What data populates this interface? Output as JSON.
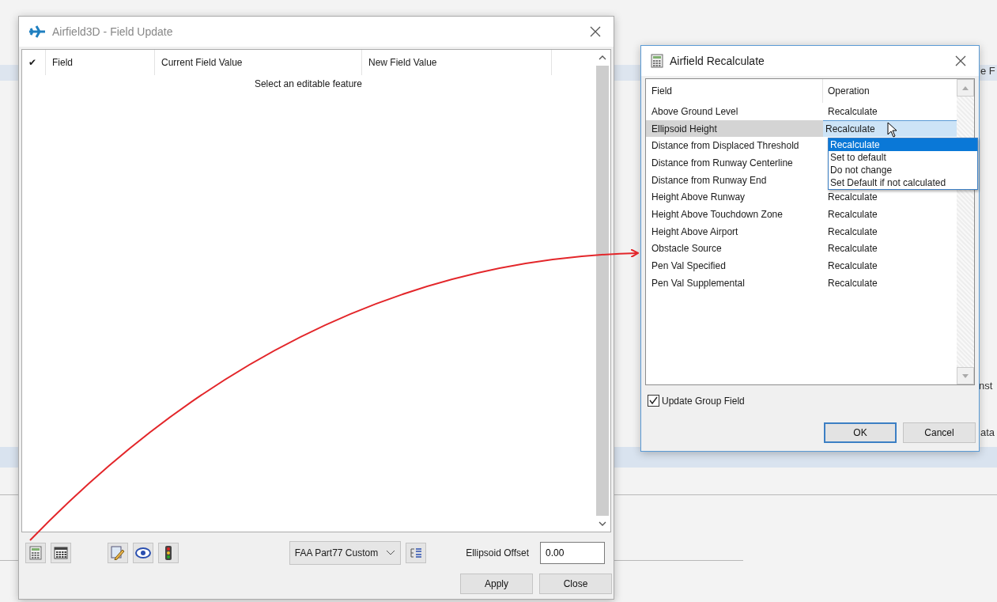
{
  "background": {
    "fragments": [
      "e F",
      "nst",
      "ata"
    ]
  },
  "field_update": {
    "title": "Airfield3D - Field Update",
    "columns": [
      "✔",
      "Field",
      "Current Field Value",
      "New Field Value"
    ],
    "empty_message": "Select an editable feature",
    "scheme": "FAA Part77 Custom",
    "offset_label": "Ellipsoid Offset",
    "offset_value": "0.00",
    "buttons": [
      "Apply",
      "Close"
    ]
  },
  "recalculate": {
    "title": "Airfield Recalculate",
    "columns": [
      "Field",
      "Operation"
    ],
    "rows": [
      {
        "field": "Above Ground Level",
        "operation": "Recalculate",
        "selected": false
      },
      {
        "field": "Ellipsoid Height",
        "operation": "Recalculate",
        "selected": true
      },
      {
        "field": "Distance from Displaced Threshold",
        "selected": false
      },
      {
        "field": "Distance from Runway Centerline",
        "selected": false
      },
      {
        "field": "Distance from Runway End",
        "selected": false
      },
      {
        "field": "Height Above Runway",
        "operation": "Recalculate",
        "selected": false
      },
      {
        "field": "Height Above Touchdown Zone",
        "operation": "Recalculate",
        "selected": false
      },
      {
        "field": "Height Above Airport",
        "operation": "Recalculate",
        "selected": false
      },
      {
        "field": "Obstacle Source",
        "operation": "Recalculate",
        "selected": false
      },
      {
        "field": "Pen Val Specified",
        "operation": "Recalculate",
        "selected": false
      },
      {
        "field": "Pen Val Supplemental",
        "operation": "Recalculate",
        "selected": false
      }
    ],
    "options": [
      {
        "label": "Recalculate",
        "selected": true
      },
      {
        "label": "Set to default",
        "selected": false
      },
      {
        "label": "Do not change",
        "selected": false
      },
      {
        "label": "Set Default if not calculated",
        "selected": false
      }
    ],
    "update_group": {
      "label": "Update Group Field",
      "checked": true
    },
    "buttons": [
      {
        "label": "OK",
        "default": true
      },
      {
        "label": "Cancel",
        "default": false
      }
    ]
  }
}
